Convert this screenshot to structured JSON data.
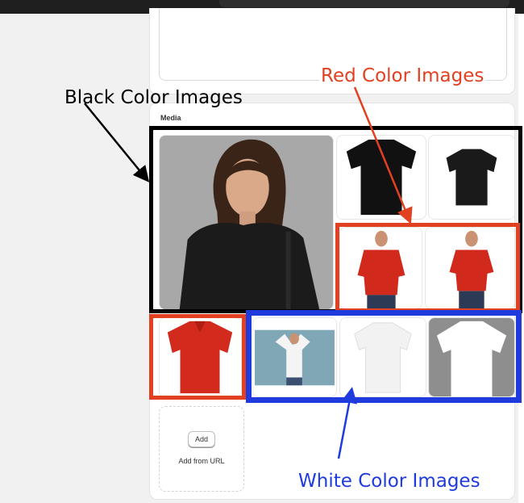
{
  "media_section": {
    "title": "Media",
    "add_button_label": "Add",
    "add_from_url_label": "Add from URL"
  },
  "annotations": {
    "black_label": "Black Color Images",
    "red_label": "Red Color Images",
    "white_label": "White Color Images"
  },
  "media_items": [
    {
      "alt": "Model wearing black t-shirt"
    },
    {
      "alt": "Black t-shirt"
    },
    {
      "alt": "Black t-shirt"
    },
    {
      "alt": "Man in red t-shirt"
    },
    {
      "alt": "Man in red polo"
    },
    {
      "alt": "Red polo shirt"
    },
    {
      "alt": "Woman in white t-shirt"
    },
    {
      "alt": "White t-shirt"
    },
    {
      "alt": "White t-shirt"
    }
  ],
  "colors": {
    "black_highlight": "#000000",
    "red_highlight": "#e24121",
    "blue_highlight": "#1f3bde"
  }
}
